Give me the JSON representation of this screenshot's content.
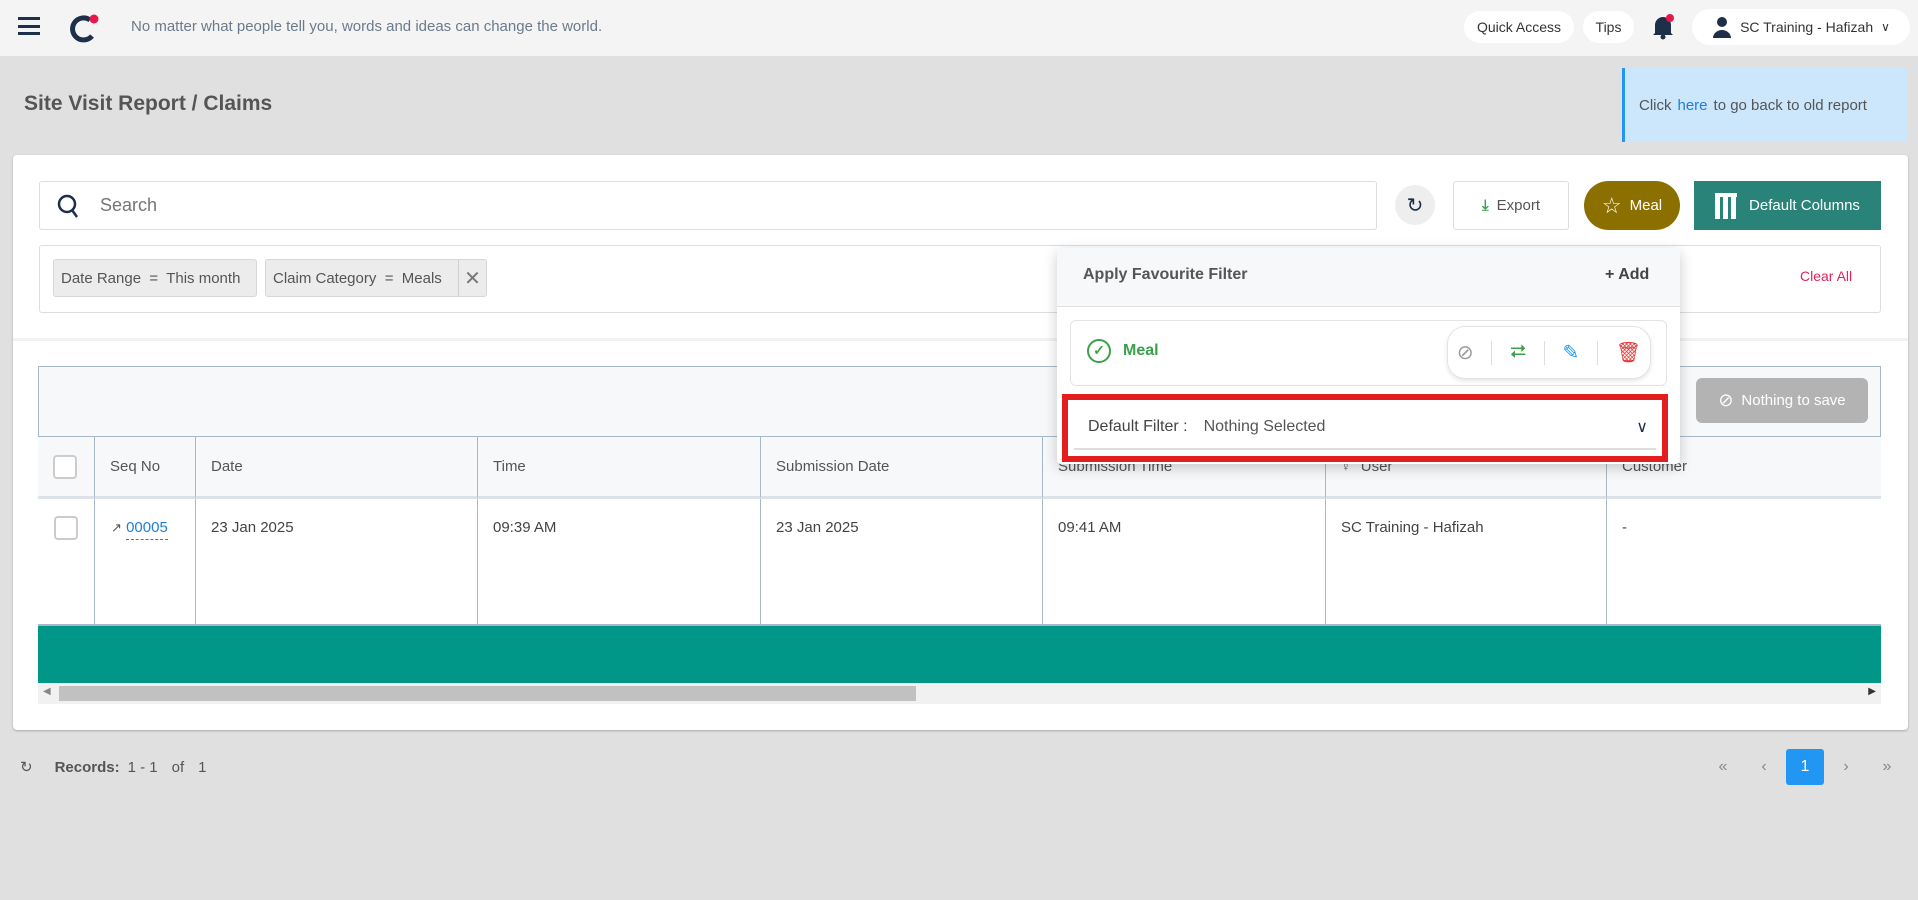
{
  "header": {
    "quote": "No matter what people tell you, words and ideas can change the world.",
    "quick_access": "Quick Access",
    "tips": "Tips",
    "user": "SC Training - Hafizah",
    "accent": "#e8174e"
  },
  "page": {
    "title": "Site Visit Report / Claims",
    "banner_pre": "Click",
    "banner_link": "here",
    "banner_post": "to go back to old report"
  },
  "toolbar": {
    "search_placeholder": "Search",
    "export": "Export",
    "meal": "Meal",
    "default_columns": "Default Columns",
    "meal_color": "#8b7000",
    "columns_color": "#2a8378"
  },
  "filters": {
    "chips": [
      "Date Range  =  This month",
      "Claim Category  =  Meals"
    ],
    "clear_all": "Clear All"
  },
  "popover": {
    "title": "Apply Favourite Filter",
    "add": "+ Add",
    "item": "Meal",
    "default_label": "Default Filter :",
    "default_value": "Nothing Selected"
  },
  "table": {
    "nothing_to_save": "Nothing to save",
    "columns": [
      "Seq No",
      "Date",
      "Time",
      "Submission Date",
      "Submission Time",
      "User",
      "Customer"
    ],
    "rows": [
      {
        "seq": "00005",
        "date": "23 Jan 2025",
        "time": "09:39 AM",
        "sub_date": "23 Jan 2025",
        "sub_time": "09:41 AM",
        "user": "SC Training - Hafizah",
        "customer": "-"
      }
    ]
  },
  "footer": {
    "records_label": "Records:",
    "range": "1 - 1",
    "of": "of",
    "total": "1",
    "page": "1"
  }
}
